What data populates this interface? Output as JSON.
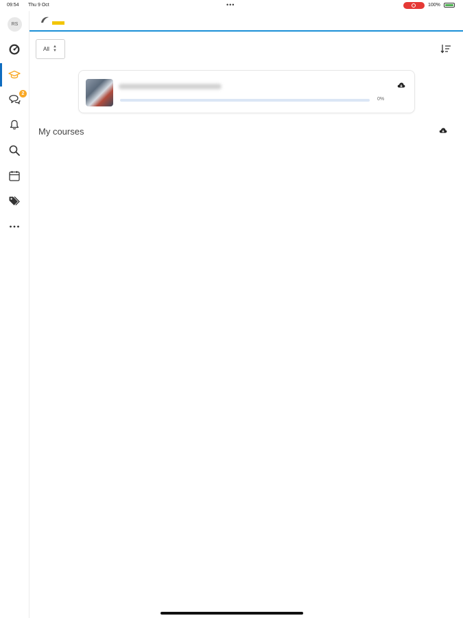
{
  "status_bar": {
    "time": "09:54",
    "date": "Thu 9 Oct",
    "battery": "100%",
    "recording": true
  },
  "sidebar": {
    "avatar_initials": "RS",
    "items": [
      {
        "name": "dashboard",
        "icon": "dashboard-icon",
        "active": false
      },
      {
        "name": "my-courses",
        "icon": "graduation-cap-icon",
        "active": true
      },
      {
        "name": "messages",
        "icon": "chat-bubbles-icon",
        "active": false,
        "badge": "2"
      },
      {
        "name": "notifications",
        "icon": "bell-icon",
        "active": false
      },
      {
        "name": "search",
        "icon": "search-icon",
        "active": false
      },
      {
        "name": "calendar",
        "icon": "calendar-icon",
        "active": false
      },
      {
        "name": "tags",
        "icon": "tags-icon",
        "active": false
      },
      {
        "name": "more",
        "icon": "more-horizontal-icon",
        "active": false
      }
    ],
    "accent": "#f9a825",
    "active_color": "#0f6cbf"
  },
  "header": {
    "logo_icon": "site-logo-icon"
  },
  "filter": {
    "selected": "All"
  },
  "sort": {
    "icon": "sort-icon"
  },
  "course_card": {
    "progress": 0,
    "progress_label": "0%",
    "download_icon": "cloud-download-icon"
  },
  "section": {
    "title": "My courses",
    "download_icon": "cloud-download-icon"
  }
}
